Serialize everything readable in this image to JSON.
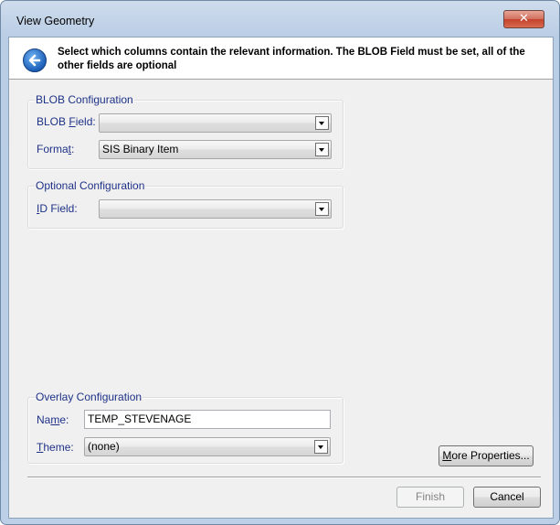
{
  "window": {
    "title": "View Geometry",
    "close_glyph": "✕"
  },
  "header": {
    "back_icon": "back-arrow-icon",
    "instruction": "Select which columns contain the relevant information. The BLOB Field must be set, all of the other fields are optional"
  },
  "blob_config": {
    "group_label": "BLOB Configuration",
    "blob_field_label_pre": "BLOB ",
    "blob_field_label_key": "F",
    "blob_field_label_post": "ield:",
    "blob_field_value": "",
    "format_label_pre": "Forma",
    "format_label_key": "t",
    "format_label_post": ":",
    "format_value": "SIS Binary Item"
  },
  "optional_config": {
    "group_label": "Optional Configuration",
    "id_field_label_key": "I",
    "id_field_label_post": "D Field:",
    "id_field_value": ""
  },
  "overlay_config": {
    "group_label": "Overlay Configuration",
    "name_label_pre": "Na",
    "name_label_key": "m",
    "name_label_post": "e:",
    "name_value": "TEMP_STEVENAGE",
    "theme_label_key": "T",
    "theme_label_post": "heme:",
    "theme_value": "(none)"
  },
  "buttons": {
    "more_properties_key": "M",
    "more_properties_post": "ore Properties...",
    "finish": "Finish",
    "cancel": "Cancel"
  }
}
